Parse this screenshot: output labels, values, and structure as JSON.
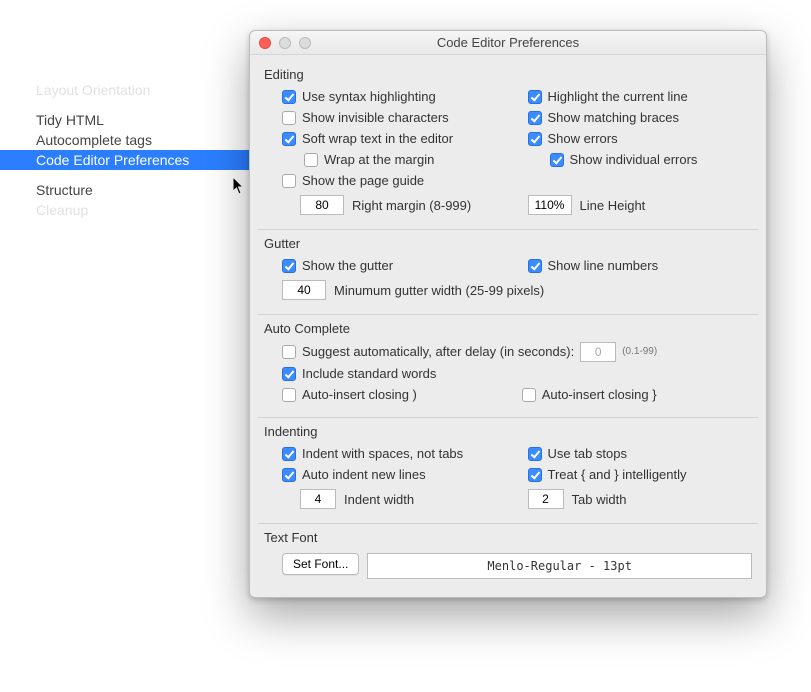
{
  "sidebar": {
    "items": [
      {
        "label": "Layout Orientation",
        "class": "faded"
      },
      {
        "label": "Tidy HTML",
        "class": ""
      },
      {
        "label": "Autocomplete tags",
        "class": ""
      },
      {
        "label": "Code Editor Preferences",
        "class": "selected"
      },
      {
        "label": "Structure",
        "class": ""
      },
      {
        "label": "Cleanup",
        "class": "faded"
      }
    ]
  },
  "window": {
    "title": "Code Editor Preferences",
    "sections": {
      "editing": {
        "title": "Editing",
        "left": [
          {
            "checked": true,
            "label": "Use syntax highlighting",
            "indent": 0
          },
          {
            "checked": false,
            "label": "Show invisible characters",
            "indent": 0
          },
          {
            "checked": true,
            "label": "Soft wrap text in the editor",
            "indent": 0
          },
          {
            "checked": false,
            "label": "Wrap at the margin",
            "indent": 1
          },
          {
            "checked": false,
            "label": "Show the page guide",
            "indent": 0
          }
        ],
        "right": [
          {
            "checked": true,
            "label": "Highlight the current line",
            "indent": 0
          },
          {
            "checked": true,
            "label": "Show matching braces",
            "indent": 0
          },
          {
            "checked": true,
            "label": "Show errors",
            "indent": 0
          },
          {
            "checked": true,
            "label": "Show individual errors",
            "indent": 1
          }
        ],
        "margin_input": "80",
        "margin_label": "Right margin (8-999)",
        "lineheight_input": "110%",
        "lineheight_label": "Line Height"
      },
      "gutter": {
        "title": "Gutter",
        "left": {
          "checked": true,
          "label": "Show the gutter"
        },
        "right": {
          "checked": true,
          "label": "Show line numbers"
        },
        "width_input": "40",
        "width_label": "Minumum gutter width (25-99 pixels)"
      },
      "autocomplete": {
        "title": "Auto Complete",
        "suggest": {
          "checked": false,
          "label": "Suggest automatically, after delay (in seconds):",
          "value": "0",
          "hint": "(0.1-99)"
        },
        "include": {
          "checked": true,
          "label": "Include standard words"
        },
        "close_paren": {
          "checked": false,
          "label": "Auto-insert closing )"
        },
        "close_brace": {
          "checked": false,
          "label": "Auto-insert closing }"
        }
      },
      "indenting": {
        "title": "Indenting",
        "left": [
          {
            "checked": true,
            "label": "Indent with spaces, not tabs"
          },
          {
            "checked": true,
            "label": "Auto indent new lines"
          }
        ],
        "right": [
          {
            "checked": true,
            "label": "Use tab stops"
          },
          {
            "checked": true,
            "label": "Treat { and } intelligently"
          }
        ],
        "indent_width_input": "4",
        "indent_width_label": "Indent width",
        "tab_width_input": "2",
        "tab_width_label": "Tab width"
      },
      "textfont": {
        "title": "Text Font",
        "button": "Set Font...",
        "display": "Menlo-Regular - 13pt"
      }
    }
  }
}
